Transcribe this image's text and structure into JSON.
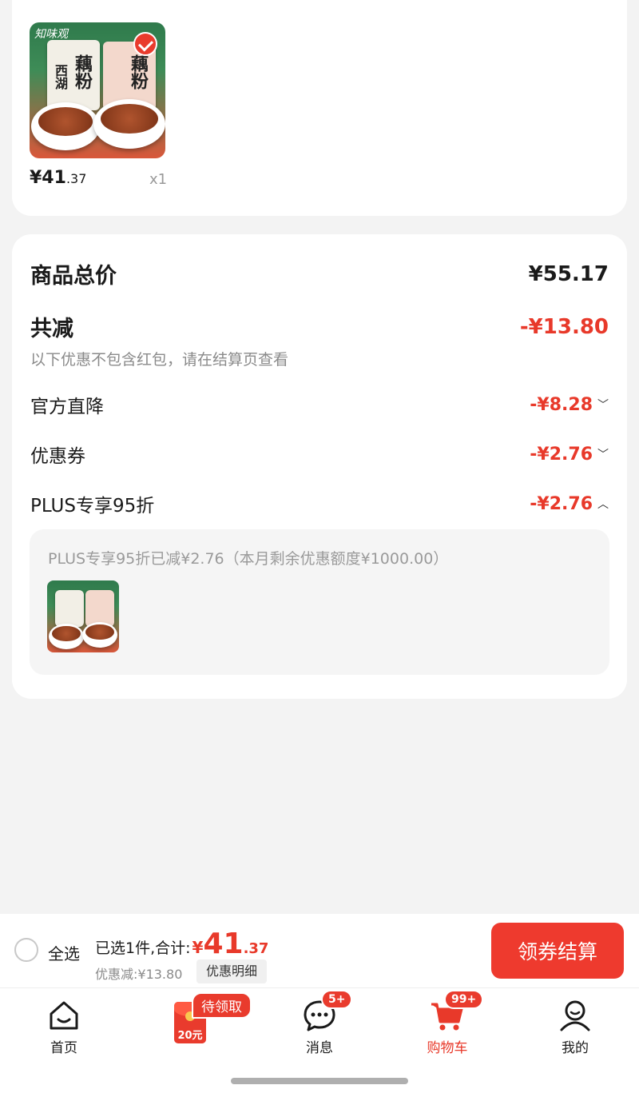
{
  "product": {
    "brand_text": "知味观",
    "bag_text_1": "藕粉",
    "bag_text_2": "西湖",
    "price_int": "¥41",
    "price_dec": ".37",
    "quantity": "x1",
    "selected": true
  },
  "summary": {
    "total_label": "商品总价",
    "total_value": "¥55.17",
    "reduce_label": "共减",
    "reduce_value": "-¥13.80",
    "hint": "以下优惠不包含红包，请在结算页查看",
    "items": [
      {
        "label": "官方直降",
        "value": "-¥8.28",
        "expanded": false
      },
      {
        "label": "优惠券",
        "value": "-¥2.76",
        "expanded": false
      },
      {
        "label": "PLUS专享95折",
        "value": "-¥2.76",
        "expanded": true
      }
    ],
    "plus_detail": "PLUS专享95折已减¥2.76（本月剩余优惠额度¥1000.00）"
  },
  "checkout": {
    "select_all": "全选",
    "selected_text": "已选1件,合计:",
    "currency": "¥",
    "total_int": "41",
    "total_dec": ".37",
    "discount_text": "优惠减:¥13.80",
    "detail_button": "优惠明细",
    "checkout_button": "领券结算"
  },
  "tabs": [
    {
      "label": "首页",
      "icon": "home-icon"
    },
    {
      "label": "",
      "icon": "red-packet-icon",
      "tag": "待领取",
      "amount": "20元"
    },
    {
      "label": "消息",
      "icon": "message-icon",
      "badge": "5+"
    },
    {
      "label": "购物车",
      "icon": "cart-icon",
      "badge": "99+",
      "active": true
    },
    {
      "label": "我的",
      "icon": "profile-icon"
    }
  ],
  "colors": {
    "accent": "#e8392a",
    "background": "#f3f3f3"
  }
}
